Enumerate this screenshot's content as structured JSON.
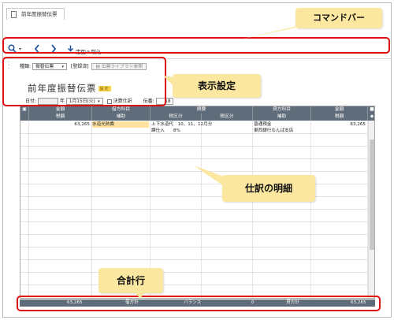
{
  "window": {
    "tab_title": "前年度振替伝票"
  },
  "toolbar": {
    "search_icon": "magnifier-icon",
    "back_icon": "chevron-left-icon",
    "forward_icon": "chevron-right-icon",
    "import_label": "定型へ取込"
  },
  "settings": {
    "type_label": "種類:",
    "type_value": "振替伝票",
    "registered_label": "[登録済]",
    "library_button": "伝票ライブラリ参照",
    "page_title": "前年度振替伝票",
    "title_badge": "設定",
    "date_label": "日付:",
    "year_suffix": "年",
    "date_value": "1月15日(火)",
    "closing_label": "決算仕訳",
    "slip_no_label": "伝番:",
    "slip_no_value": "18"
  },
  "grid": {
    "header_row1": [
      "金額",
      "借方科目",
      "摘要",
      "貸方科目",
      "金額"
    ],
    "header_row2": [
      "税額",
      "補助",
      "税区分",
      "税区分",
      "補助",
      "税額"
    ],
    "rows": [
      {
        "debit_amount": "63,265",
        "debit_account": "水道光熱費",
        "summary": "上下水道代　10、11、12月分",
        "credit_account": "普通預金",
        "credit_amount": "63,265"
      },
      {
        "debit_amount": "",
        "debit_account": "",
        "summary": "課仕入　　8%",
        "credit_account": "東西銀行なんば支店",
        "credit_amount": ""
      }
    ]
  },
  "footer": {
    "debit_total": "63,265",
    "debit_total_label": "借方計",
    "balance_label": "バランス",
    "balance_value": "0",
    "credit_total_label": "貸方計",
    "credit_total": "63,265"
  },
  "callouts": {
    "command_bar": "コマンドバー",
    "display_settings": "表示設定",
    "journal_details": "仕訳の明細",
    "total_row": "合計行"
  },
  "colors": {
    "annotation_red": "#e01010",
    "callout_fill": "#fbe7a0",
    "grid_header": "#5f6c79",
    "highlight": "#ffe2a0"
  }
}
